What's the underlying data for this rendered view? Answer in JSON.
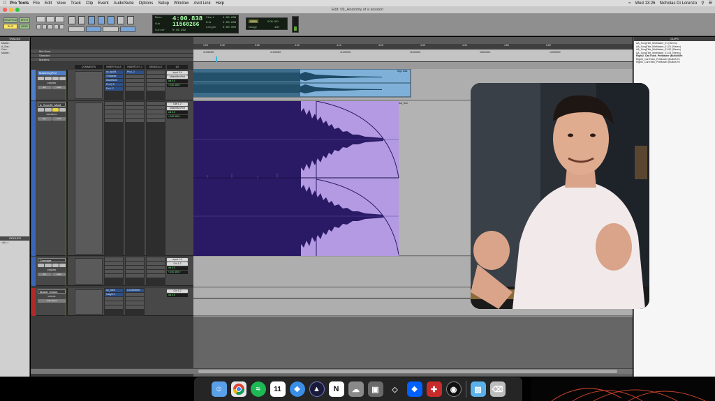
{
  "menubar": {
    "app_name": "Pro Tools",
    "items": [
      "File",
      "Edit",
      "View",
      "Track",
      "Clip",
      "Event",
      "AudioSuite",
      "Options",
      "Setup",
      "Window",
      "Avid Link",
      "Help"
    ],
    "clock": "Wed 13:26",
    "user": "Nicholas Di Lorenzo"
  },
  "window": {
    "title": "Edit: 09_Anatomy of a session"
  },
  "toolbar": {
    "modes": {
      "shuffle": "SHUFFLE",
      "spot": "SPOT",
      "slip": "SLIP",
      "grid": "GRID"
    },
    "counter": {
      "main_label": "Main",
      "main_value": "4:00.838",
      "sub_label": "Sub",
      "sub_value": "11560266",
      "start_label": "Start",
      "start_value": "4:00.838",
      "end_label": "End",
      "end_value": "4:00.838",
      "length_label": "Length",
      "length_value": "0:00.000",
      "cursor_label": "Cursor",
      "cursor_value": "0:46.262"
    },
    "nudge": {
      "label": "Nudge",
      "grid_value": "0:00.100",
      "nudge_value": "100"
    }
  },
  "tracks_panel": {
    "header": "TRACKS",
    "items": [
      "Master...",
      "A_Son...",
      "Com...",
      "Master..."
    ],
    "groups_header": "GROUPS",
    "groups_items": [
      "<ALL>"
    ]
  },
  "mix": {
    "ruler_rows": [
      "Min:Secs",
      "Samples",
      "Markers"
    ],
    "column_headers": [
      "COMMENTS",
      "INSERTS A-E",
      "INSERTS F-J",
      "SENDS A-E",
      "I/O"
    ],
    "tracks": [
      {
        "name": "MasteringPrnt",
        "automation": "playlists",
        "view_btns": [
          "dyn",
          "read"
        ],
        "inserts_a": [
          "ax_dg494",
          "TGMaster",
          "WaveShell",
          "Pro-Q 3",
          "Pro-L 2"
        ],
        "inserts_f": [
          "Pro-L 2"
        ],
        "io": [
          "Input 3-4",
          "MasterBusPrnt"
        ],
        "vol": "vol",
        "vol_value": "0.0",
        "pan": "< 100",
        "pan_r": "100 >"
      },
      {
        "name": "A_SongTit_MixM",
        "automation": "waveform",
        "view_btns": [
          "dyn",
          "read"
        ],
        "io": [
          "Dial 1-2",
          "MasterBusPrnt"
        ],
        "vol": "vol",
        "vol_value": "0.0",
        "pan": "< 100",
        "pan_r": "100 >"
      },
      {
        "name": "Compare",
        "automation": "playlists",
        "view_btns": [
          "dyn",
          "read"
        ],
        "io": [
          "Input 1-2",
          "Out 1-2"
        ],
        "vol": "vol",
        "vol_value": "0.0",
        "pan": "< 100",
        "pan_r": "100 >"
      },
      {
        "name": "Master Output",
        "automation": "volume",
        "view_btns": [
          "Automated"
        ],
        "inserts_a": [
          "op_prdm",
          "Insight 2"
        ],
        "inserts_f": [
          "LUN10Meter"
        ],
        "io": [
          "Out 1-2"
        ],
        "vol": "vol",
        "vol_value": "0.0"
      }
    ]
  },
  "edit": {
    "timeline_labels": [
      "1:00",
      "3:40",
      "3:50",
      "4:00",
      "4:10",
      "4:20",
      "4:30",
      "4:40",
      "4:50",
      "5:00"
    ],
    "sample_labels": [
      "11000000",
      "11200000",
      "11400000",
      "11600000",
      "11800000",
      "12000000"
    ],
    "clip_names": [
      "Mg1 Mas",
      "AA_Son"
    ]
  },
  "clips": {
    "header": "CLIPS",
    "items": [
      {
        "label": "AA_SongTitle_MixMaster_01 (Stereo)",
        "bold": false
      },
      {
        "label": "AA_SongTitle_MixMaster_01-01 (Stereo)",
        "bold": false
      },
      {
        "label": "AA_SongTitle_MixMaster_01-02 (Stereo)",
        "bold": false
      },
      {
        "label": "AA_SongTitle_MixMaster_01-03 (Stereo)",
        "bold": false
      },
      {
        "label": "Right2_CanThink_PreMaster (Bufloif-Re",
        "bold": true
      },
      {
        "label": "Right2_CanThink_PreMaster (Bufloif-Re",
        "bold": false
      },
      {
        "label": "Right2_CanThink_PreMaster (Bufloif-Re",
        "bold": false
      }
    ]
  },
  "dock": {
    "apps": [
      "finder-icon",
      "chrome-icon",
      "spotify-icon",
      "calendar-icon",
      "safari-icon",
      "pro-tools-icon",
      "notion-icon",
      "preview-icon",
      "screenshot-icon",
      "dropbox-icon",
      "appstore-icon",
      "obs-icon",
      "folder-icon",
      "trash-icon"
    ],
    "calendar_day": "11"
  },
  "colors": {
    "waveform_fill": "#2a1a66",
    "selection": "#b39ae3",
    "clip_blue": "#7fb0d8",
    "track_blue": "#4f7fc8",
    "counter_green": "#7fff8f"
  }
}
